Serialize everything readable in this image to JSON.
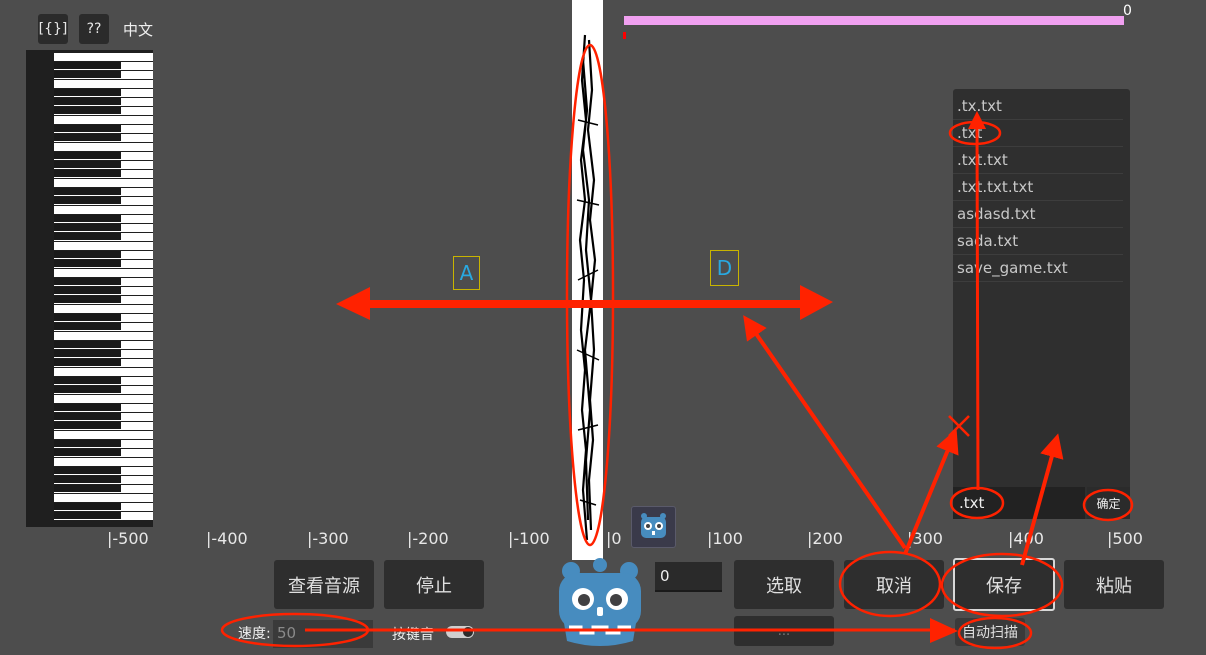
{
  "toolbar": {
    "json_label": "[{}]",
    "help_label": "??",
    "lang_label": "中文"
  },
  "progress": {
    "value_text": "0",
    "fill_fraction": 1.0,
    "bar_color": "#f0a0f0"
  },
  "markers": {
    "a_label": "A",
    "d_label": "D"
  },
  "ruler": {
    "ticks": [
      "|-500",
      "|-400",
      "|-300",
      "|-200",
      "|-100",
      "|0",
      "|100",
      "|200",
      "|300",
      "|400",
      "|500"
    ]
  },
  "file_dialog": {
    "files": [
      ".tx.txt",
      ".txt",
      ".txt.txt",
      ".txt.txt.txt",
      "asdasd.txt",
      "sada.txt",
      "save_game.txt"
    ],
    "filename_value": ".txt",
    "confirm_label": "确定"
  },
  "controls": {
    "view_source_label": "查看音源",
    "stop_label": "停止",
    "number_value": "0",
    "select_label": "选取",
    "cancel_label": "取消",
    "save_label": "保存",
    "paste_label": "粘贴",
    "speed_label": "速度:",
    "speed_value": "50",
    "key_sound_label": "按键音",
    "auto_scan_label": "自动扫描",
    "hidden_button_label": "..."
  },
  "colors": {
    "annotation": "#ff2200",
    "marker_text": "#29a8e0",
    "marker_border": "#c8b400"
  },
  "icons": {
    "logo": "godot-logo-icon"
  }
}
